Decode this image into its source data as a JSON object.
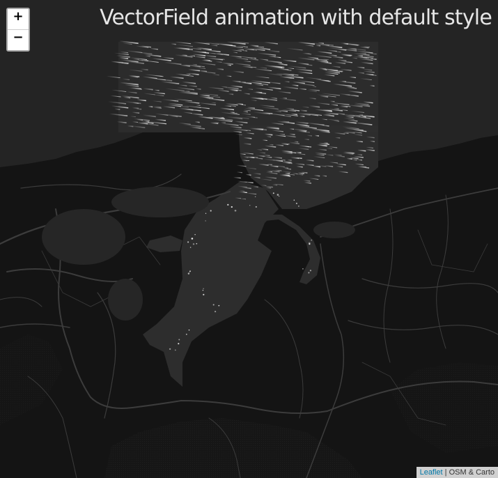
{
  "title": "VectorField animation with default style",
  "zoom": {
    "in_label": "+",
    "out_label": "−"
  },
  "attribution": {
    "link_label": "Leaflet",
    "separator": " | ",
    "credit": "OSM & Carto"
  },
  "colors": {
    "land": "#151515",
    "sea": "#242424",
    "field_layer": "#2e2e2e",
    "roads": "#3a3a3a",
    "particles": "#ffffff"
  }
}
